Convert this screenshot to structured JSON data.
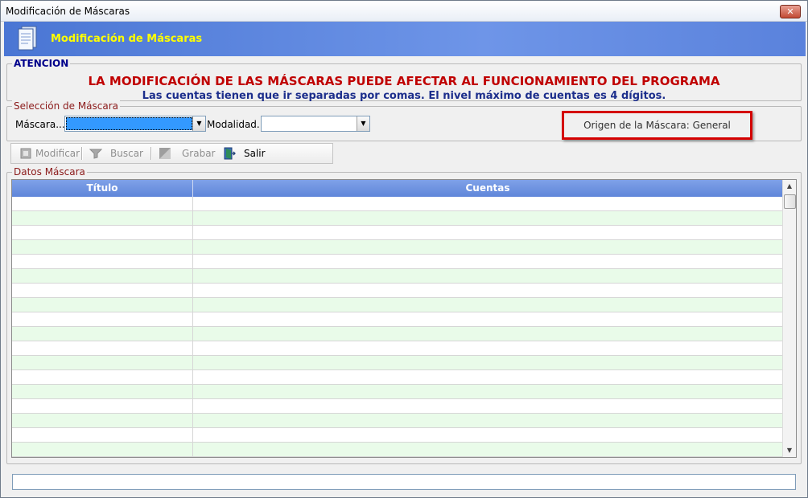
{
  "window": {
    "title": "Modificación de Máscaras",
    "close_label": "✕"
  },
  "banner": {
    "title": "Modificación de Máscaras",
    "icon": "documents-icon"
  },
  "attention": {
    "legend": "ATENCION",
    "warning_line1": "LA MODIFICACIÓN DE LAS MÁSCARAS PUEDE AFECTAR AL FUNCIONAMIENTO DEL PROGRAMA",
    "warning_line2": "Las cuentas tienen que ir separadas por comas. El nivel máximo de cuentas es 4 dígitos.",
    "colors": {
      "warning": "#c00000",
      "info": "#1c2e8c"
    }
  },
  "selection": {
    "legend": "Selección de Máscara",
    "mascara_label": "Máscara...",
    "mascara_value": "",
    "modalidad_label": "Modalidad..",
    "modalidad_value": "",
    "origin_text": "Origen de la Máscara: General",
    "highlight_color": "#d40000"
  },
  "toolbar": {
    "items": [
      {
        "label": "Modificar",
        "icon": "edit-icon",
        "enabled": false
      },
      {
        "label": "Buscar",
        "icon": "funnel-icon",
        "enabled": false
      },
      {
        "label": "Grabar",
        "icon": "save-icon",
        "enabled": false
      },
      {
        "label": "Salir",
        "icon": "exit-door-icon",
        "enabled": true
      }
    ]
  },
  "datos": {
    "legend": "Datos Máscara",
    "columns": [
      "Título",
      "Cuentas"
    ],
    "header_color": "#6f92de",
    "alt_row_color": "#e9fbe9"
  },
  "status": {
    "text": ""
  }
}
